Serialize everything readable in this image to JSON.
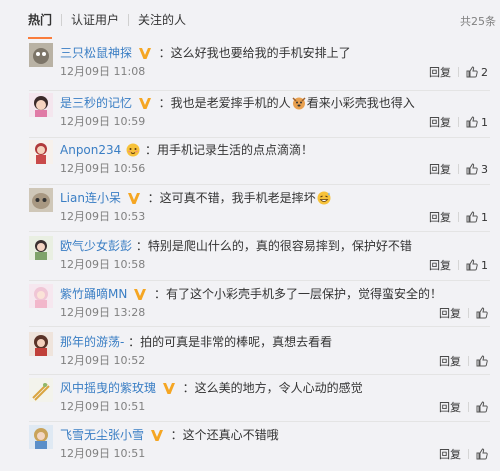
{
  "tabs": [
    "热门",
    "认证用户",
    "关注的人"
  ],
  "total_count": "共25条",
  "accent_colors": {
    "nickname": "#3a7ec4",
    "vip_badge": "#f5a623",
    "active_tab": "#fa7d3c"
  },
  "comments": [
    {
      "nick": "三只松鼠神探",
      "text": "：这么好我也要给我的手机安排上了",
      "time": "12月09日 11:08",
      "reply": "回复",
      "likes": "2"
    },
    {
      "nick": "是三秒的记忆",
      "text_a": "：我也是老爱摔手机的人",
      "text_b": "看来小彩壳我也得入",
      "time": "12月09日 10:59",
      "reply": "回复",
      "likes": "1"
    },
    {
      "nick": "Anpon234",
      "text": "：用手机记录生活的点点滴滴！",
      "time": "12月09日 10:56",
      "reply": "回复",
      "likes": "3"
    },
    {
      "nick": "Lian连小呆",
      "text": "：这可真不错，我手机老是摔坏",
      "time": "12月09日 10:53",
      "reply": "回复",
      "likes": "1"
    },
    {
      "nick": "欧气少女彭彭",
      "text": "：特别是爬山什么的，真的很容易摔到，保护好不错",
      "time": "12月09日 10:58",
      "reply": "回复",
      "likes": "1"
    },
    {
      "nick": "紫竹踊嘀MN",
      "text": "：有了这个小彩壳手机多了一层保护，觉得蛮安全的！",
      "time": "12月09日 13:28",
      "reply": "回复"
    },
    {
      "nick": "那年的游荡-",
      "text": "：拍的可真是非常的棒呢，真想去看看",
      "time": "12月09日 10:52",
      "reply": "回复"
    },
    {
      "nick": "风中摇曳的紫玫瑰",
      "text": "：这么美的地方，令人心动的感觉",
      "time": "12月09日 10:51",
      "reply": "回复"
    },
    {
      "nick": "飞雪无尘张小雪",
      "text": "：这个还真心不错哦",
      "time": "12月09日 10:51",
      "reply": "回复"
    }
  ]
}
